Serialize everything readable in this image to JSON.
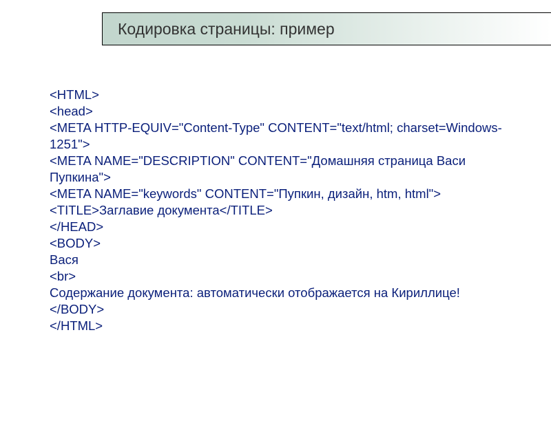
{
  "header": {
    "title": "Кодировка страницы: пример"
  },
  "code": {
    "lines": [
      "<HTML>",
      "<head>",
      "<META HTTP-EQUIV=\"Content-Type\" CONTENT=\"text/html; charset=Windows-1251\">",
      "<META NAME=\"DESCRIPTION\" CONTENT=\"Домашняя страница Васи Пупкина\">",
      "<META NAME=\"keywords\" CONTENT=\"Пупкин, дизайн, htm, html\">",
      "<TITLE>Заглавие документа</TITLE>",
      "</HEAD>",
      "<BODY>",
      "Вася",
      "<br>",
      "Содержание документа: автоматически отображается на Кириллице!",
      "</BODY>",
      "</HTML>"
    ]
  }
}
